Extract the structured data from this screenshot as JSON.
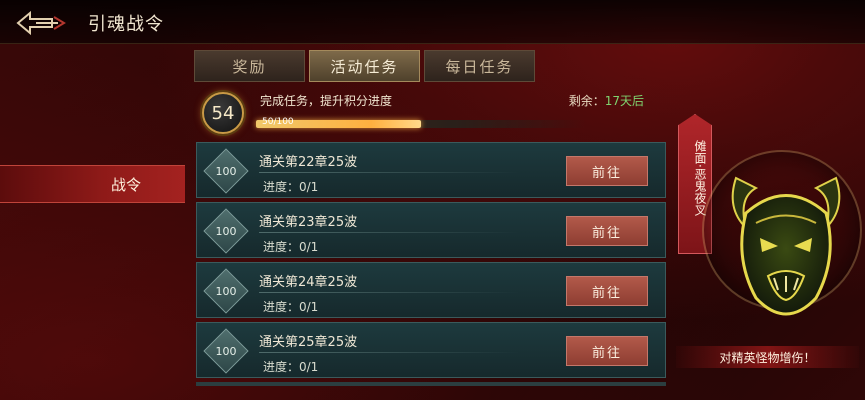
{
  "header": {
    "title": "引魂战令"
  },
  "tabs": [
    {
      "label": "奖励",
      "active": false
    },
    {
      "label": "活动任务",
      "active": true
    },
    {
      "label": "每日任务",
      "active": false
    }
  ],
  "sidebar": {
    "items": [
      {
        "label": "战令",
        "active": true
      }
    ]
  },
  "progress": {
    "level": "54",
    "description": "完成任务，提升积分进度",
    "remaining_label": "剩余：",
    "remaining_days": "17天后",
    "value_text": "50/100",
    "fraction": 0.5
  },
  "tasks": [
    {
      "reward": "100",
      "title": "通关第22章25波",
      "progress": "进度：0/1",
      "button": "前往"
    },
    {
      "reward": "100",
      "title": "通关第23章25波",
      "progress": "进度：0/1",
      "button": "前往"
    },
    {
      "reward": "100",
      "title": "通关第24章25波",
      "progress": "进度：0/1",
      "button": "前往"
    },
    {
      "reward": "100",
      "title": "通关第25章25波",
      "progress": "进度：0/1",
      "button": "前往"
    }
  ],
  "boss": {
    "name": "傩面·恶鬼夜叉",
    "buff": "对精英怪物增伤！"
  },
  "colors": {
    "accent_red": "#a42220",
    "progress_gold": "#ffb040",
    "remaining_green": "#7fd36f",
    "task_bg": "#1d3a3e",
    "button_red": "#b25a4a"
  }
}
